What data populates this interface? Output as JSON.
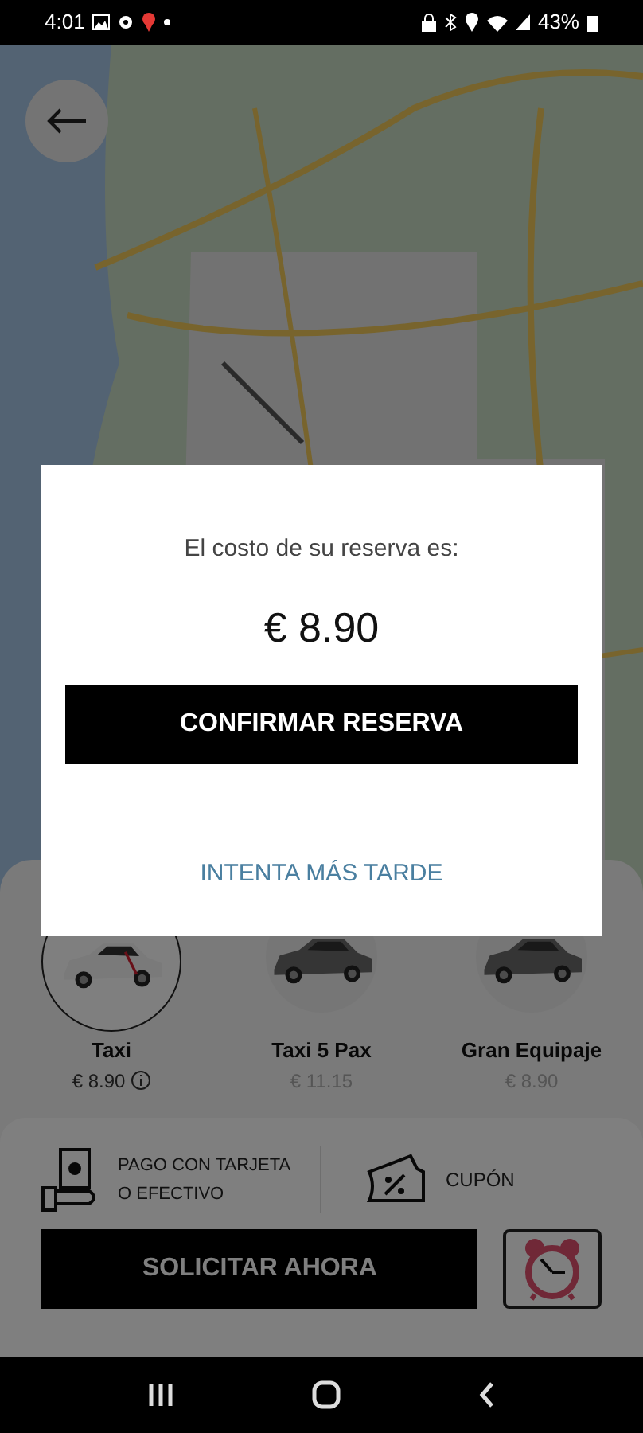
{
  "status_bar": {
    "time": "4:01",
    "battery": "43%"
  },
  "dialog": {
    "message": "El costo de su reserva es:",
    "price": "€ 8.90",
    "confirm_button": "CONFIRMAR RESERVA",
    "later_link": "INTENTA MÁS TARDE"
  },
  "vehicles": [
    {
      "name": "Taxi",
      "price": "€ 8.90",
      "selected": true,
      "info": true
    },
    {
      "name": "Taxi 5 Pax",
      "price": "€ 11.15",
      "selected": false,
      "info": false
    },
    {
      "name": "Gran Equipaje",
      "price": "€ 8.90",
      "selected": false,
      "info": false
    }
  ],
  "payment": {
    "label": "PAGO CON TARJETA O EFECTIVO"
  },
  "coupon": {
    "label": "CUPÓN"
  },
  "request_button": "SOLICITAR AHORA"
}
